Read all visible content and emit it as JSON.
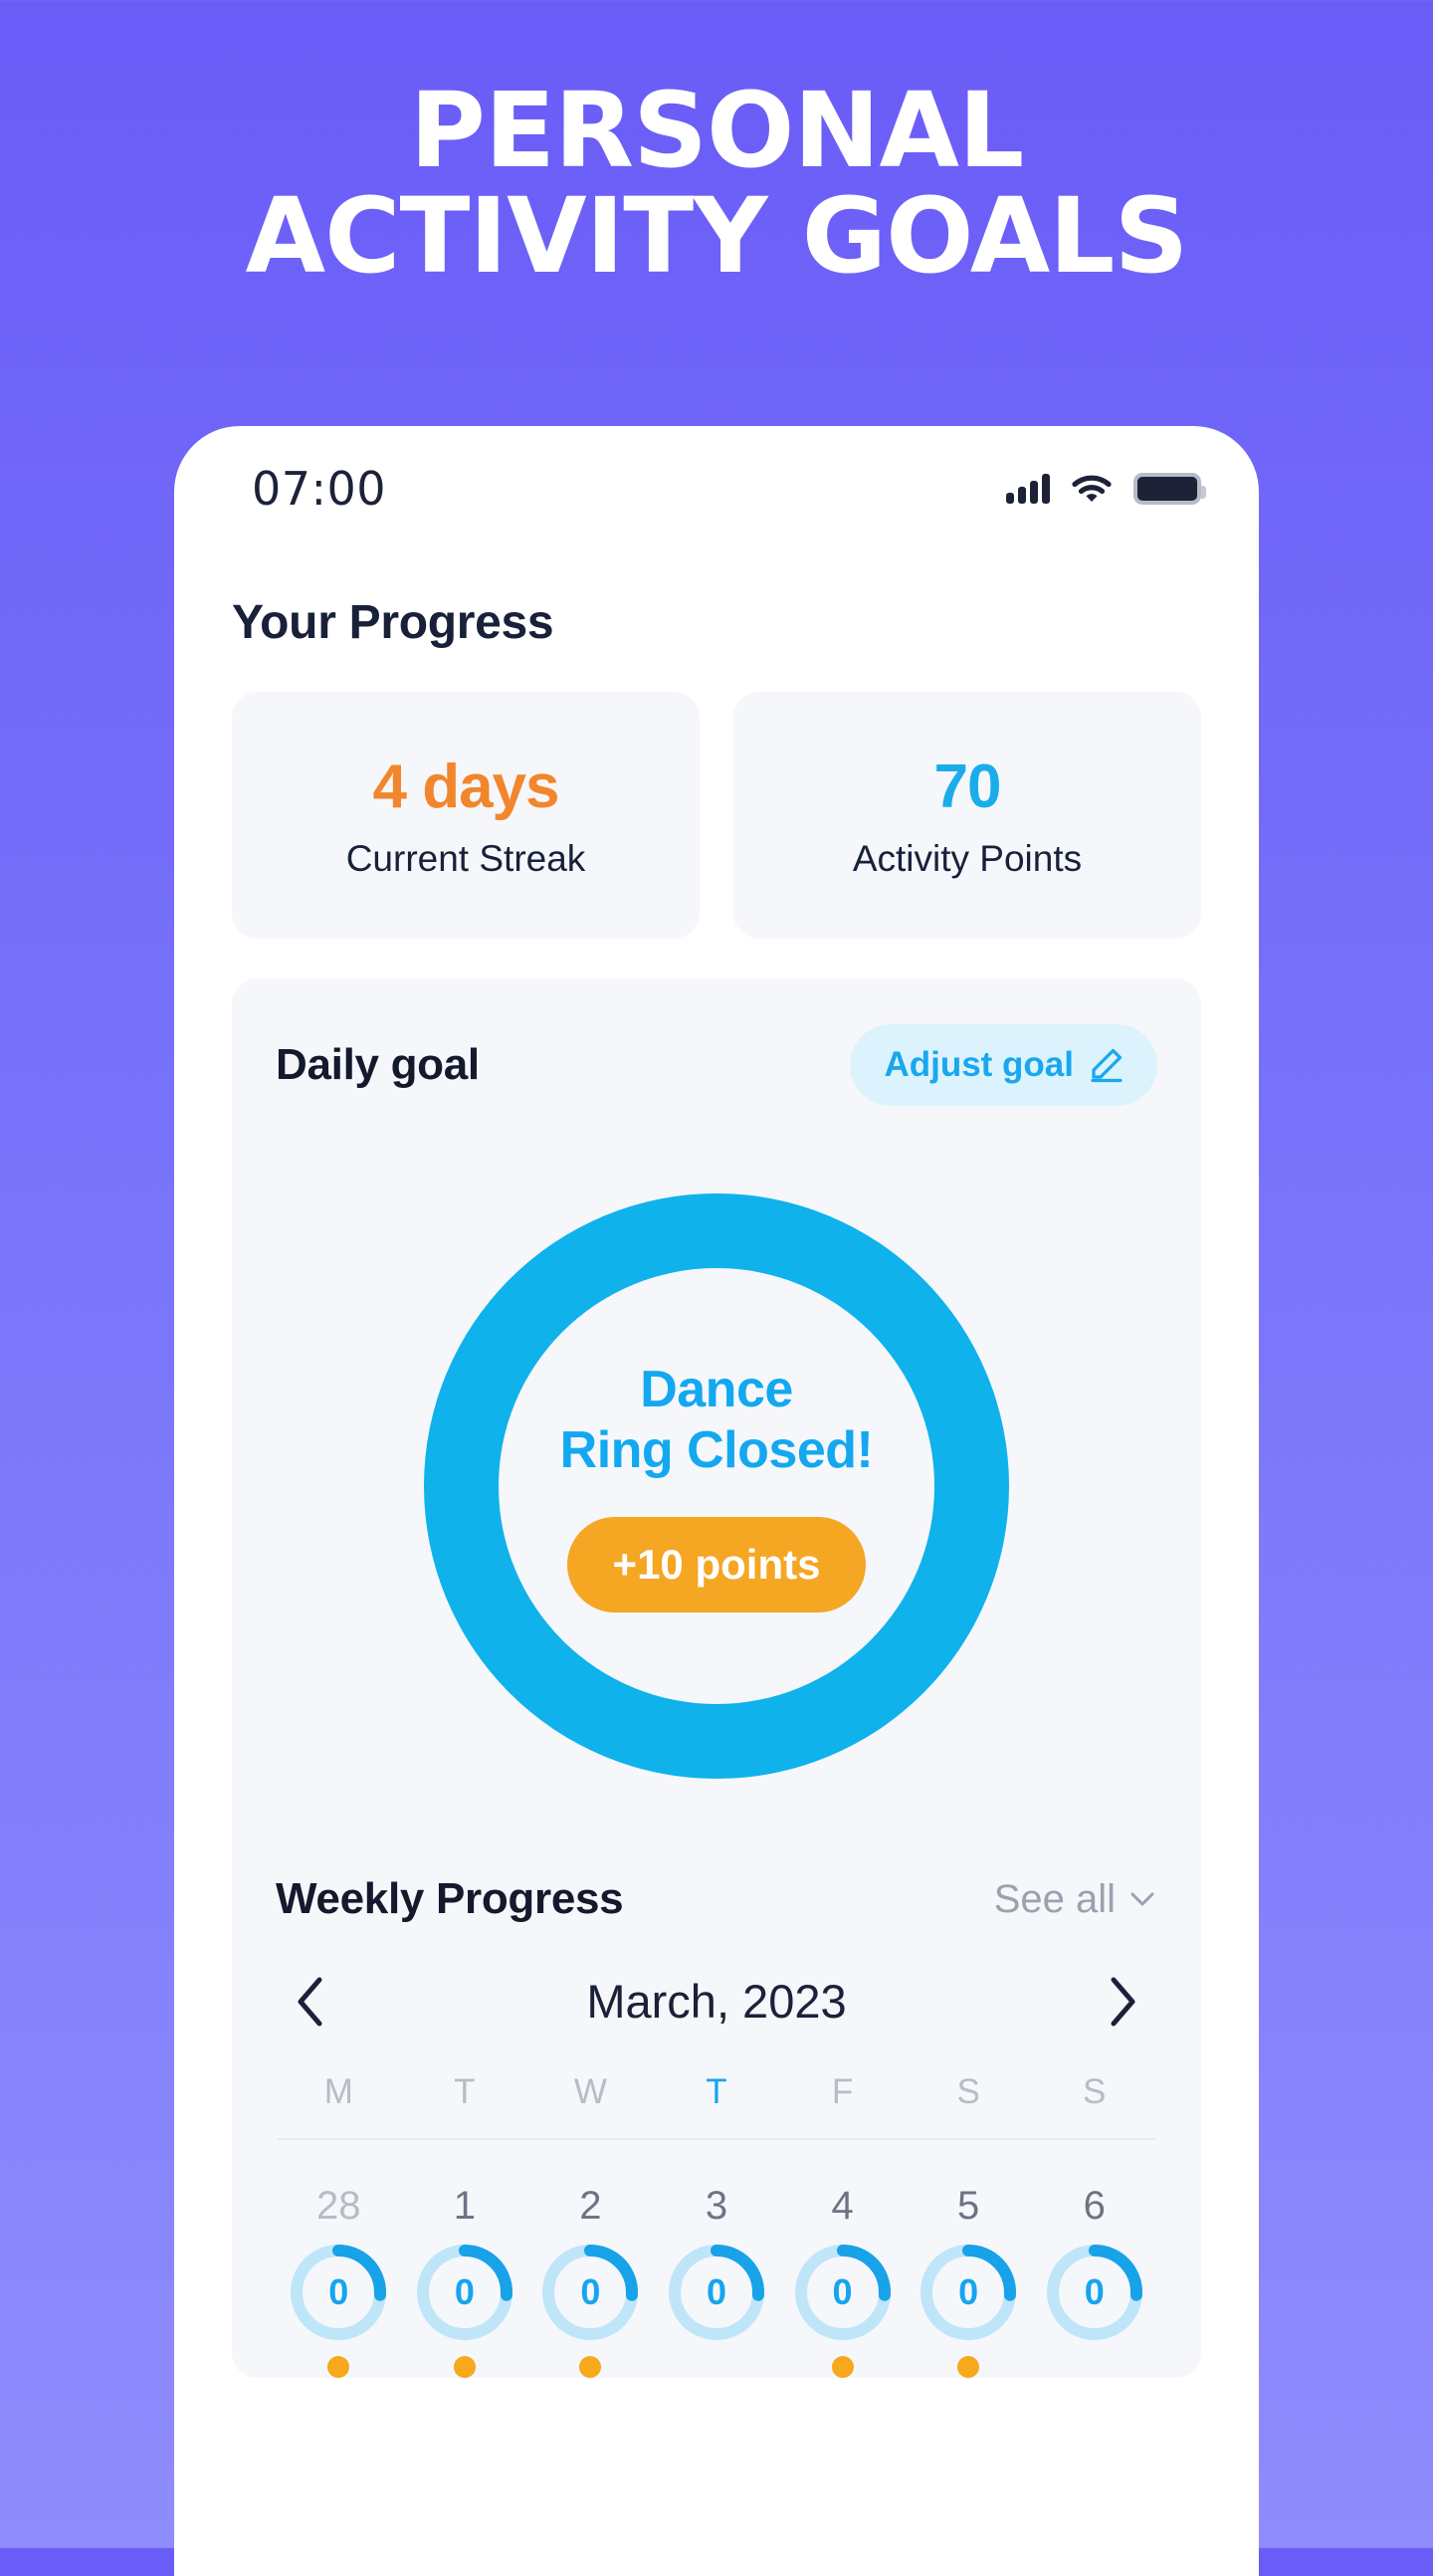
{
  "hero": {
    "line1": "PERSONAL",
    "line2": "ACTIVITY GOALS"
  },
  "status_bar": {
    "time": "07:00",
    "signal_icon": "cellular-signal-icon",
    "wifi_icon": "wifi-icon",
    "battery_icon": "battery-full-icon"
  },
  "progress": {
    "section_title": "Your Progress",
    "cards": [
      {
        "value": "4 days",
        "label": "Current Streak",
        "color": "#f2862c"
      },
      {
        "value": "70",
        "label": "Activity Points",
        "color": "#1aade9"
      }
    ]
  },
  "daily_goal": {
    "title": "Daily goal",
    "adjust_label": "Adjust goal",
    "adjust_icon": "pencil-edit-icon",
    "ring": {
      "line1": "Dance",
      "line2": "Ring Closed!",
      "points_label": "+10 points",
      "progress_percent": 100,
      "ring_color": "#0fb2eb",
      "points_color": "#f5a623"
    }
  },
  "weekly": {
    "title": "Weekly Progress",
    "see_all_label": "See all",
    "see_all_icon": "chevron-down-icon",
    "prev_icon": "chevron-left-icon",
    "next_icon": "chevron-right-icon",
    "month_label": "March, 2023",
    "weekdays": [
      {
        "label": "M",
        "active": false
      },
      {
        "label": "T",
        "active": false
      },
      {
        "label": "W",
        "active": false
      },
      {
        "label": "T",
        "active": true
      },
      {
        "label": "F",
        "active": false
      },
      {
        "label": "S",
        "active": false
      },
      {
        "label": "S",
        "active": false
      }
    ],
    "days": [
      {
        "num": "28",
        "muted": true,
        "value": "0",
        "percent": 26,
        "dot": true
      },
      {
        "num": "1",
        "muted": false,
        "value": "0",
        "percent": 26,
        "dot": true
      },
      {
        "num": "2",
        "muted": false,
        "value": "0",
        "percent": 26,
        "dot": true
      },
      {
        "num": "3",
        "muted": false,
        "value": "0",
        "percent": 26,
        "dot": false
      },
      {
        "num": "4",
        "muted": false,
        "value": "0",
        "percent": 26,
        "dot": true
      },
      {
        "num": "5",
        "muted": false,
        "value": "0",
        "percent": 26,
        "dot": true
      },
      {
        "num": "6",
        "muted": false,
        "value": "0",
        "percent": 26,
        "dot": false
      }
    ]
  },
  "theme": {
    "bg_top": "#6a5cf7",
    "bg_bottom": "#8f8cfd",
    "accent_blue": "#17a6ef",
    "accent_orange": "#f5a623",
    "card_bg": "#f5f7fb",
    "text_dark": "#14192c"
  }
}
